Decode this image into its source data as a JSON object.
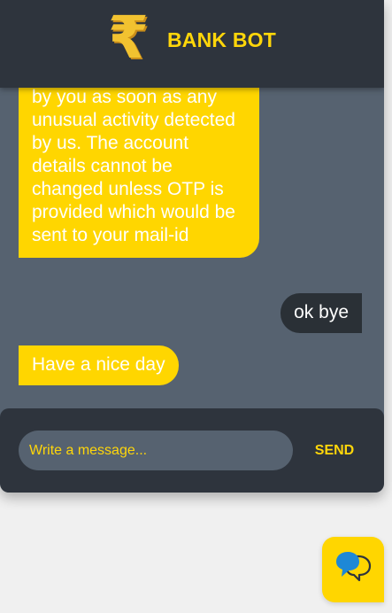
{
  "header": {
    "title": "BANK BOT",
    "logo_icon": "rupee-icon",
    "logo_glyph": "₹"
  },
  "messages": [
    {
      "sender": "bot",
      "text": "by you as soon as any unusual activity detected by us. The account details cannot be changed unless OTP is provided which would be sent to your mail-id"
    },
    {
      "sender": "user",
      "text": "ok bye"
    },
    {
      "sender": "bot",
      "text": "Have a nice day"
    }
  ],
  "composer": {
    "placeholder": "Write a message...",
    "send_label": "SEND"
  },
  "launcher": {
    "icon": "chat-bubbles-icon"
  },
  "colors": {
    "accent": "#ffd600",
    "header_bg": "#2e343d",
    "chat_bg": "#566270",
    "user_bubble": "#2a3036",
    "page_bg": "#f0f0f0"
  }
}
